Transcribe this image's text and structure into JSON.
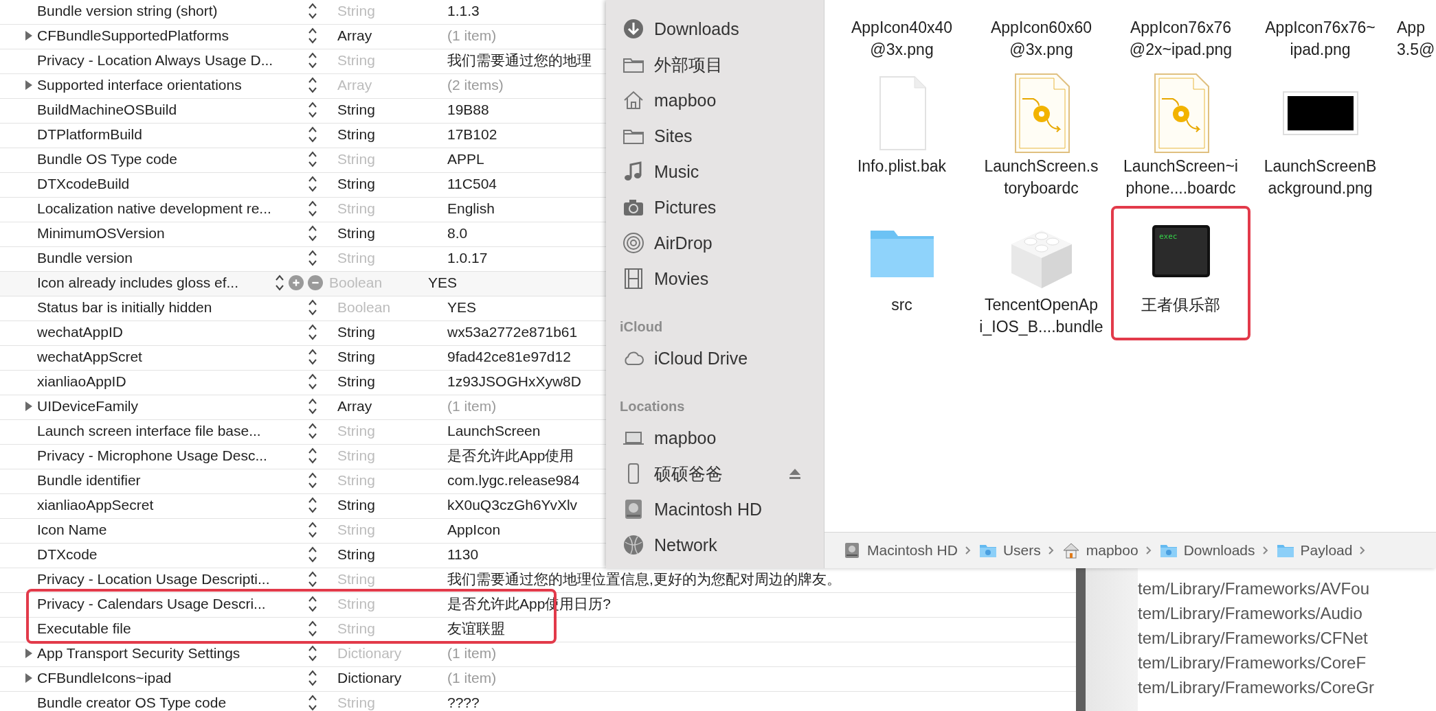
{
  "plist": {
    "rows": [
      {
        "key": "Bundle version string (short)",
        "kind": "value",
        "type": "String",
        "type_dimmed": true,
        "value": "1.1.3",
        "hovered": false,
        "highlighted": false
      },
      {
        "key": "CFBundleSupportedPlatforms",
        "kind": "container",
        "type": "Array",
        "type_dimmed": false,
        "value": "(1 item)",
        "hovered": false,
        "highlighted": false
      },
      {
        "key": "Privacy - Location Always Usage D...",
        "kind": "value",
        "type": "String",
        "type_dimmed": true,
        "value": "我们需要通过您的地理",
        "hovered": false,
        "highlighted": false
      },
      {
        "key": "Supported interface orientations",
        "kind": "container",
        "type": "Array",
        "type_dimmed": true,
        "value": "(2 items)",
        "hovered": false,
        "highlighted": false
      },
      {
        "key": "BuildMachineOSBuild",
        "kind": "value",
        "type": "String",
        "type_dimmed": false,
        "value": "19B88",
        "hovered": false,
        "highlighted": false
      },
      {
        "key": "DTPlatformBuild",
        "kind": "value",
        "type": "String",
        "type_dimmed": false,
        "value": "17B102",
        "hovered": false,
        "highlighted": false
      },
      {
        "key": "Bundle OS Type code",
        "kind": "value",
        "type": "String",
        "type_dimmed": true,
        "value": "APPL",
        "hovered": false,
        "highlighted": false
      },
      {
        "key": "DTXcodeBuild",
        "kind": "value",
        "type": "String",
        "type_dimmed": false,
        "value": "11C504",
        "hovered": false,
        "highlighted": false
      },
      {
        "key": "Localization native development re...",
        "kind": "value",
        "type": "String",
        "type_dimmed": true,
        "value": "English",
        "hovered": false,
        "highlighted": false
      },
      {
        "key": "MinimumOSVersion",
        "kind": "value",
        "type": "String",
        "type_dimmed": false,
        "value": "8.0",
        "hovered": false,
        "highlighted": false
      },
      {
        "key": "Bundle version",
        "kind": "value",
        "type": "String",
        "type_dimmed": true,
        "value": "1.0.17",
        "hovered": false,
        "highlighted": false
      },
      {
        "key": "Icon already includes gloss ef...",
        "kind": "value",
        "type": "Boolean",
        "type_dimmed": true,
        "value": "YES",
        "hovered": true,
        "highlighted": false
      },
      {
        "key": "Status bar is initially hidden",
        "kind": "value",
        "type": "Boolean",
        "type_dimmed": true,
        "value": "YES",
        "hovered": false,
        "highlighted": false
      },
      {
        "key": "wechatAppID",
        "kind": "value",
        "type": "String",
        "type_dimmed": false,
        "value": "wx53a2772e871b61",
        "hovered": false,
        "highlighted": false
      },
      {
        "key": "wechatAppScret",
        "kind": "value",
        "type": "String",
        "type_dimmed": false,
        "value": "9fad42ce81e97d12",
        "hovered": false,
        "highlighted": false
      },
      {
        "key": "xianliaoAppID",
        "kind": "value",
        "type": "String",
        "type_dimmed": false,
        "value": "1z93JSOGHxXyw8D",
        "hovered": false,
        "highlighted": false
      },
      {
        "key": "UIDeviceFamily",
        "kind": "container",
        "type": "Array",
        "type_dimmed": false,
        "value": "(1 item)",
        "hovered": false,
        "highlighted": false
      },
      {
        "key": "Launch screen interface file base...",
        "kind": "value",
        "type": "String",
        "type_dimmed": true,
        "value": "LaunchScreen",
        "hovered": false,
        "highlighted": false
      },
      {
        "key": "Privacy - Microphone Usage Desc...",
        "kind": "value",
        "type": "String",
        "type_dimmed": true,
        "value": "是否允许此App使用",
        "hovered": false,
        "highlighted": false
      },
      {
        "key": "Bundle identifier",
        "kind": "value",
        "type": "String",
        "type_dimmed": true,
        "value": "com.lygc.release984",
        "hovered": false,
        "highlighted": false
      },
      {
        "key": "xianliaoAppSecret",
        "kind": "value",
        "type": "String",
        "type_dimmed": false,
        "value": "kX0uQ3czGh6YvXlv",
        "hovered": false,
        "highlighted": false
      },
      {
        "key": "Icon Name",
        "kind": "value",
        "type": "String",
        "type_dimmed": true,
        "value": "AppIcon",
        "hovered": false,
        "highlighted": false
      },
      {
        "key": "DTXcode",
        "kind": "value",
        "type": "String",
        "type_dimmed": false,
        "value": "1130",
        "hovered": false,
        "highlighted": false
      },
      {
        "key": "Privacy - Location Usage Descripti...",
        "kind": "value",
        "type": "String",
        "type_dimmed": true,
        "value": "我们需要通过您的地理位置信息,更好的为您配对周边的牌友。",
        "hovered": false,
        "highlighted": false
      },
      {
        "key": "Privacy - Calendars Usage Descri...",
        "kind": "value",
        "type": "String",
        "type_dimmed": true,
        "value": "是否允许此App使用日历?",
        "hovered": false,
        "highlighted": true
      },
      {
        "key": "Executable file",
        "kind": "value",
        "type": "String",
        "type_dimmed": true,
        "value": "友谊联盟",
        "hovered": false,
        "highlighted": true
      },
      {
        "key": "App Transport Security Settings",
        "kind": "container",
        "type": "Dictionary",
        "type_dimmed": true,
        "value": "(1 item)",
        "hovered": false,
        "highlighted": false
      },
      {
        "key": "CFBundleIcons~ipad",
        "kind": "container",
        "type": "Dictionary",
        "type_dimmed": false,
        "value": "(1 item)",
        "hovered": false,
        "highlighted": false
      },
      {
        "key": "Bundle creator OS Type code",
        "kind": "value",
        "type": "String",
        "type_dimmed": true,
        "value": "????",
        "hovered": false,
        "highlighted": false
      }
    ]
  },
  "finder": {
    "sidebar": [
      {
        "items": [
          {
            "label": "Downloads",
            "kind": "downloads",
            "ejectable": false
          },
          {
            "label": "外部项目",
            "kind": "folder",
            "ejectable": false
          },
          {
            "label": "mapboo",
            "kind": "home",
            "ejectable": false
          },
          {
            "label": "Sites",
            "kind": "folder",
            "ejectable": false
          },
          {
            "label": "Music",
            "kind": "music",
            "ejectable": false
          },
          {
            "label": "Pictures",
            "kind": "pictures",
            "ejectable": false
          },
          {
            "label": "AirDrop",
            "kind": "airdrop",
            "ejectable": false
          },
          {
            "label": "Movies",
            "kind": "movies",
            "ejectable": false
          }
        ]
      },
      {
        "header": "iCloud",
        "items": [
          {
            "label": "iCloud Drive",
            "kind": "cloud",
            "ejectable": false
          }
        ]
      },
      {
        "header": "Locations",
        "items": [
          {
            "label": "mapboo",
            "kind": "computer",
            "ejectable": false
          },
          {
            "label": "硕硕爸爸",
            "kind": "phone",
            "ejectable": true
          },
          {
            "label": "Macintosh HD",
            "kind": "disk",
            "ejectable": false
          },
          {
            "label": "Network",
            "kind": "network",
            "ejectable": false
          }
        ]
      }
    ],
    "file_rows": [
      [
        {
          "name_lines": [
            "AppIcon40x40",
            "@3x.png"
          ],
          "highlighted": false,
          "cut_off": false
        },
        {
          "name_lines": [
            "AppIcon60x60",
            "@3x.png"
          ],
          "highlighted": false,
          "cut_off": false
        },
        {
          "name_lines": [
            "AppIcon76x76",
            "@2x~ipad.png"
          ],
          "highlighted": false,
          "cut_off": false
        },
        {
          "name_lines": [
            "AppIcon76x76~",
            "ipad.png"
          ],
          "highlighted": false,
          "cut_off": false
        },
        {
          "name_lines": [
            "App",
            "3.5@"
          ],
          "highlighted": false,
          "cut_off": true
        }
      ],
      [
        {
          "kind": "blank",
          "name_lines": [
            "Info.plist.bak"
          ],
          "highlighted": false,
          "cut_off": false
        },
        {
          "kind": "storyboard",
          "name_lines": [
            "LaunchScreen.s",
            "toryboardc"
          ],
          "highlighted": false,
          "cut_off": false
        },
        {
          "kind": "storyboard",
          "name_lines": [
            "LaunchScreen~i",
            "phone....boardc"
          ],
          "highlighted": false,
          "cut_off": false
        },
        {
          "kind": "image",
          "name_lines": [
            "LaunchScreenB",
            "ackground.png"
          ],
          "highlighted": false,
          "cut_off": false
        }
      ],
      [
        {
          "kind": "folder",
          "name_lines": [
            "src"
          ],
          "highlighted": false,
          "cut_off": false
        },
        {
          "kind": "bundle",
          "name_lines": [
            "TencentOpenAp",
            "i_IOS_B....bundle"
          ],
          "highlighted": false,
          "cut_off": false
        },
        {
          "kind": "exec",
          "icon_text": "exec",
          "name_lines": [
            "王者俱乐部"
          ],
          "highlighted": true,
          "cut_off": false
        }
      ]
    ],
    "path_bar": [
      {
        "label": "Macintosh HD",
        "kind": "disk"
      },
      {
        "label": "Users",
        "kind": "users"
      },
      {
        "label": "mapboo",
        "kind": "home"
      },
      {
        "label": "Downloads",
        "kind": "downloads"
      },
      {
        "label": "Payload",
        "kind": "folder"
      }
    ]
  },
  "log_lines": [
    "tem/Library/Frameworks/AVFou",
    "tem/Library/Frameworks/Audio",
    "tem/Library/Frameworks/CFNet",
    "tem/Library/Frameworks/CoreF",
    "tem/Library/Frameworks/CoreGr"
  ]
}
